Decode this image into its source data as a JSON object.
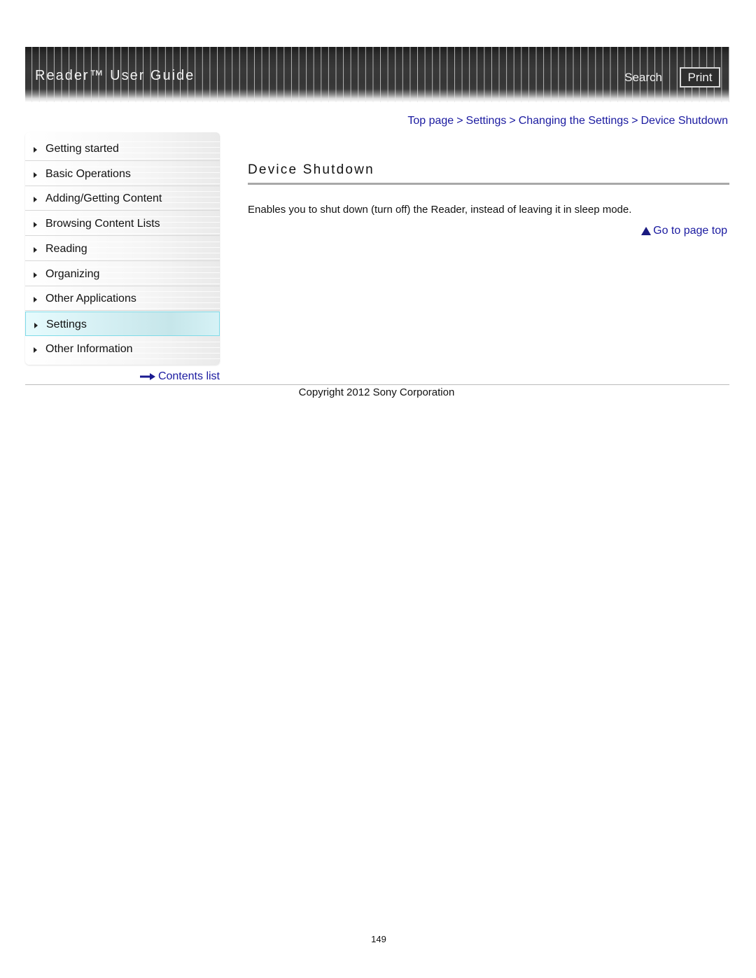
{
  "header": {
    "title": "Reader™ User Guide",
    "search_label": "Search",
    "print_label": "Print"
  },
  "breadcrumb": {
    "items": [
      "Top page",
      "Settings",
      "Changing the Settings",
      "Device Shutdown"
    ],
    "separator": ">"
  },
  "sidebar": {
    "items": [
      {
        "label": "Getting started",
        "active": false
      },
      {
        "label": "Basic Operations",
        "active": false
      },
      {
        "label": "Adding/Getting Content",
        "active": false
      },
      {
        "label": "Browsing Content Lists",
        "active": false
      },
      {
        "label": "Reading",
        "active": false
      },
      {
        "label": "Organizing",
        "active": false
      },
      {
        "label": "Other Applications",
        "active": false
      },
      {
        "label": "Settings",
        "active": true
      },
      {
        "label": "Other Information",
        "active": false
      }
    ],
    "contents_link": "Contents list"
  },
  "main": {
    "title": "Device Shutdown",
    "body": "Enables you to shut down (turn off) the Reader, instead of leaving it in sleep mode.",
    "page_top_link": "Go to page top"
  },
  "footer": {
    "copyright": "Copyright 2012 Sony Corporation",
    "page_number": "149"
  },
  "colors": {
    "link": "#1a1aa0",
    "active_nav_bg": "#d3eef2",
    "active_nav_border": "#7fdbe8",
    "header_bg": "#363636"
  }
}
